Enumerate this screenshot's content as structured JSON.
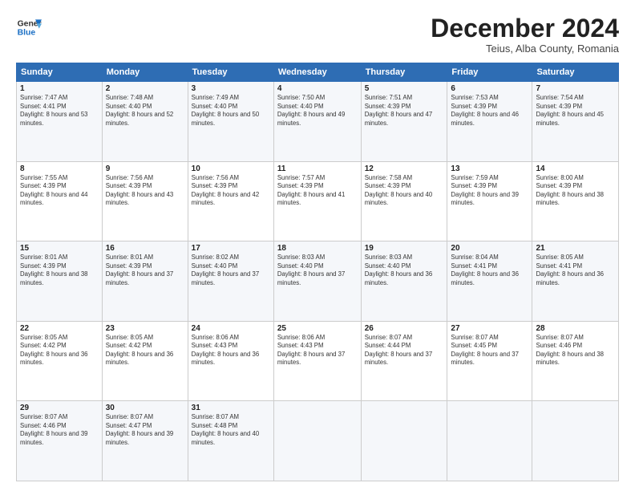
{
  "logo": {
    "line1": "General",
    "line2": "Blue"
  },
  "header": {
    "title": "December 2024",
    "subtitle": "Teius, Alba County, Romania"
  },
  "weekdays": [
    "Sunday",
    "Monday",
    "Tuesday",
    "Wednesday",
    "Thursday",
    "Friday",
    "Saturday"
  ],
  "weeks": [
    [
      {
        "day": "1",
        "sunrise": "Sunrise: 7:47 AM",
        "sunset": "Sunset: 4:41 PM",
        "daylight": "Daylight: 8 hours and 53 minutes."
      },
      {
        "day": "2",
        "sunrise": "Sunrise: 7:48 AM",
        "sunset": "Sunset: 4:40 PM",
        "daylight": "Daylight: 8 hours and 52 minutes."
      },
      {
        "day": "3",
        "sunrise": "Sunrise: 7:49 AM",
        "sunset": "Sunset: 4:40 PM",
        "daylight": "Daylight: 8 hours and 50 minutes."
      },
      {
        "day": "4",
        "sunrise": "Sunrise: 7:50 AM",
        "sunset": "Sunset: 4:40 PM",
        "daylight": "Daylight: 8 hours and 49 minutes."
      },
      {
        "day": "5",
        "sunrise": "Sunrise: 7:51 AM",
        "sunset": "Sunset: 4:39 PM",
        "daylight": "Daylight: 8 hours and 47 minutes."
      },
      {
        "day": "6",
        "sunrise": "Sunrise: 7:53 AM",
        "sunset": "Sunset: 4:39 PM",
        "daylight": "Daylight: 8 hours and 46 minutes."
      },
      {
        "day": "7",
        "sunrise": "Sunrise: 7:54 AM",
        "sunset": "Sunset: 4:39 PM",
        "daylight": "Daylight: 8 hours and 45 minutes."
      }
    ],
    [
      {
        "day": "8",
        "sunrise": "Sunrise: 7:55 AM",
        "sunset": "Sunset: 4:39 PM",
        "daylight": "Daylight: 8 hours and 44 minutes."
      },
      {
        "day": "9",
        "sunrise": "Sunrise: 7:56 AM",
        "sunset": "Sunset: 4:39 PM",
        "daylight": "Daylight: 8 hours and 43 minutes."
      },
      {
        "day": "10",
        "sunrise": "Sunrise: 7:56 AM",
        "sunset": "Sunset: 4:39 PM",
        "daylight": "Daylight: 8 hours and 42 minutes."
      },
      {
        "day": "11",
        "sunrise": "Sunrise: 7:57 AM",
        "sunset": "Sunset: 4:39 PM",
        "daylight": "Daylight: 8 hours and 41 minutes."
      },
      {
        "day": "12",
        "sunrise": "Sunrise: 7:58 AM",
        "sunset": "Sunset: 4:39 PM",
        "daylight": "Daylight: 8 hours and 40 minutes."
      },
      {
        "day": "13",
        "sunrise": "Sunrise: 7:59 AM",
        "sunset": "Sunset: 4:39 PM",
        "daylight": "Daylight: 8 hours and 39 minutes."
      },
      {
        "day": "14",
        "sunrise": "Sunrise: 8:00 AM",
        "sunset": "Sunset: 4:39 PM",
        "daylight": "Daylight: 8 hours and 38 minutes."
      }
    ],
    [
      {
        "day": "15",
        "sunrise": "Sunrise: 8:01 AM",
        "sunset": "Sunset: 4:39 PM",
        "daylight": "Daylight: 8 hours and 38 minutes."
      },
      {
        "day": "16",
        "sunrise": "Sunrise: 8:01 AM",
        "sunset": "Sunset: 4:39 PM",
        "daylight": "Daylight: 8 hours and 37 minutes."
      },
      {
        "day": "17",
        "sunrise": "Sunrise: 8:02 AM",
        "sunset": "Sunset: 4:40 PM",
        "daylight": "Daylight: 8 hours and 37 minutes."
      },
      {
        "day": "18",
        "sunrise": "Sunrise: 8:03 AM",
        "sunset": "Sunset: 4:40 PM",
        "daylight": "Daylight: 8 hours and 37 minutes."
      },
      {
        "day": "19",
        "sunrise": "Sunrise: 8:03 AM",
        "sunset": "Sunset: 4:40 PM",
        "daylight": "Daylight: 8 hours and 36 minutes."
      },
      {
        "day": "20",
        "sunrise": "Sunrise: 8:04 AM",
        "sunset": "Sunset: 4:41 PM",
        "daylight": "Daylight: 8 hours and 36 minutes."
      },
      {
        "day": "21",
        "sunrise": "Sunrise: 8:05 AM",
        "sunset": "Sunset: 4:41 PM",
        "daylight": "Daylight: 8 hours and 36 minutes."
      }
    ],
    [
      {
        "day": "22",
        "sunrise": "Sunrise: 8:05 AM",
        "sunset": "Sunset: 4:42 PM",
        "daylight": "Daylight: 8 hours and 36 minutes."
      },
      {
        "day": "23",
        "sunrise": "Sunrise: 8:05 AM",
        "sunset": "Sunset: 4:42 PM",
        "daylight": "Daylight: 8 hours and 36 minutes."
      },
      {
        "day": "24",
        "sunrise": "Sunrise: 8:06 AM",
        "sunset": "Sunset: 4:43 PM",
        "daylight": "Daylight: 8 hours and 36 minutes."
      },
      {
        "day": "25",
        "sunrise": "Sunrise: 8:06 AM",
        "sunset": "Sunset: 4:43 PM",
        "daylight": "Daylight: 8 hours and 37 minutes."
      },
      {
        "day": "26",
        "sunrise": "Sunrise: 8:07 AM",
        "sunset": "Sunset: 4:44 PM",
        "daylight": "Daylight: 8 hours and 37 minutes."
      },
      {
        "day": "27",
        "sunrise": "Sunrise: 8:07 AM",
        "sunset": "Sunset: 4:45 PM",
        "daylight": "Daylight: 8 hours and 37 minutes."
      },
      {
        "day": "28",
        "sunrise": "Sunrise: 8:07 AM",
        "sunset": "Sunset: 4:46 PM",
        "daylight": "Daylight: 8 hours and 38 minutes."
      }
    ],
    [
      {
        "day": "29",
        "sunrise": "Sunrise: 8:07 AM",
        "sunset": "Sunset: 4:46 PM",
        "daylight": "Daylight: 8 hours and 39 minutes."
      },
      {
        "day": "30",
        "sunrise": "Sunrise: 8:07 AM",
        "sunset": "Sunset: 4:47 PM",
        "daylight": "Daylight: 8 hours and 39 minutes."
      },
      {
        "day": "31",
        "sunrise": "Sunrise: 8:07 AM",
        "sunset": "Sunset: 4:48 PM",
        "daylight": "Daylight: 8 hours and 40 minutes."
      },
      null,
      null,
      null,
      null
    ]
  ]
}
